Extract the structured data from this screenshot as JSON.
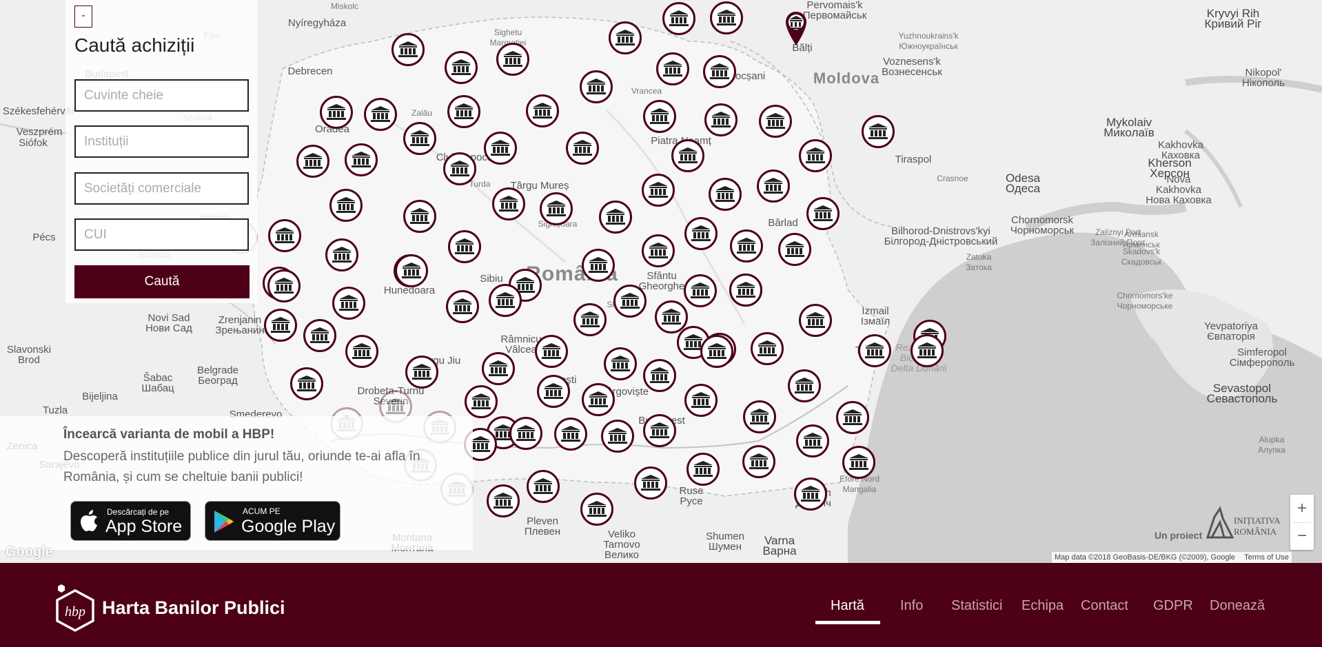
{
  "search_panel": {
    "collapse_label": "-",
    "title": "Caută achiziții",
    "keywords_placeholder": "Cuvinte cheie",
    "institutions_placeholder": "Instituții",
    "companies_placeholder": "Societăți comerciale",
    "cui_placeholder": "CUI",
    "search_button": "Caută"
  },
  "promo": {
    "title": "Încearcă varianta de mobil a HBP!",
    "text": "Descoperă instituțiile publice din jurul tău, oriunde te-ai afla în România, și cum se cheltuie banii publici!",
    "app_store": {
      "line1": "Descărcați de pe",
      "line2": "App Store"
    },
    "google_play": {
      "line1": "ACUM PE",
      "line2": "Google Play"
    }
  },
  "map": {
    "zoom_in": "+",
    "zoom_out": "−",
    "google_logo": "Google",
    "attribution": "Map data ©2018 GeoBasis-DE/BKG (©2009), Google",
    "terms": "Terms of Use",
    "project_by": "Un proiect",
    "partner_logo": "INIȚIATIVA ROMÂNIA",
    "labels": [
      {
        "t": "Miskolc",
        "k": "sm"
      },
      {
        "t": "Eger",
        "k": "sm"
      },
      {
        "t": "Nyíregyháza",
        "k": ""
      },
      {
        "t": "Sighetu\nMarmației",
        "k": "sm"
      },
      {
        "t": "Budapest",
        "k": ""
      },
      {
        "t": "Debrecen",
        "k": ""
      },
      {
        "t": "Bălți",
        "k": ""
      },
      {
        "t": "Moldova",
        "k": "country"
      },
      {
        "t": "Székesfehérvár",
        "k": ""
      },
      {
        "t": "Veszprém",
        "k": ""
      },
      {
        "t": "Siófok",
        "k": ""
      },
      {
        "t": "Szolnok",
        "k": "sm"
      },
      {
        "t": "Oradea",
        "k": ""
      },
      {
        "t": "Zalău",
        "k": "sm"
      },
      {
        "t": "Cluj-Napoca",
        "k": ""
      },
      {
        "t": "Târgu Mureș",
        "k": ""
      },
      {
        "t": "Piatra Neamț",
        "k": ""
      },
      {
        "t": "Tiraspol",
        "k": ""
      },
      {
        "t": "Szeged",
        "k": "sm"
      },
      {
        "t": "Pécs",
        "k": ""
      },
      {
        "t": "Turda",
        "k": "sm"
      },
      {
        "t": "Sighișoara",
        "k": "sm"
      },
      {
        "t": "Bârlad",
        "k": ""
      },
      {
        "t": "Subotica",
        "k": "sm"
      },
      {
        "t": "Sibiu",
        "k": ""
      },
      {
        "t": "România",
        "k": "big"
      },
      {
        "t": "Sfântu\nGheorghe",
        "k": ""
      },
      {
        "t": "Hunedoara",
        "k": ""
      },
      {
        "t": "Novi Sad\nНови Сад",
        "k": ""
      },
      {
        "t": "Zrenjanin\nЗрењанин",
        "k": ""
      },
      {
        "t": "Sinaia",
        "k": "sm"
      },
      {
        "t": "Slavonski\nBrod",
        "k": ""
      },
      {
        "t": "Târgu Jiu",
        "k": ""
      },
      {
        "t": "Belgrade\nБеоград",
        "k": ""
      },
      {
        "t": "Šabac\nШабац",
        "k": ""
      },
      {
        "t": "Drobeta-Turnu\nSeverin",
        "k": ""
      },
      {
        "t": "Pitești",
        "k": ""
      },
      {
        "t": "Târgoviște",
        "k": ""
      },
      {
        "t": "Bijeljina",
        "k": ""
      },
      {
        "t": "Tuzla",
        "k": ""
      },
      {
        "t": "Smederevo",
        "k": ""
      },
      {
        "t": "Zenica",
        "k": ""
      },
      {
        "t": "Sarajevo",
        "k": ""
      },
      {
        "t": "Montana\nМонтана",
        "k": ""
      },
      {
        "t": "Pleven\nПлевен",
        "k": ""
      },
      {
        "t": "Veliko\nTarnovo\nВелико",
        "k": ""
      },
      {
        "t": "Ruse\nРусе",
        "k": ""
      },
      {
        "t": "Shumen\nШумен",
        "k": ""
      },
      {
        "t": "Varna\nВарна",
        "k": "dark"
      },
      {
        "t": "Dobrich\nДобрич",
        "k": ""
      },
      {
        "t": "Efore Nord\nMangalia",
        "k": "sm"
      },
      {
        "t": "Tulcea",
        "k": ""
      },
      {
        "t": "Izmail\nІзмаїл",
        "k": ""
      },
      {
        "t": "Rezervația\nBiosferei\nDelta Dunării",
        "k": "sea"
      },
      {
        "t": "Bilhorod-Dnistrovs'kyi\nБілгород-Дністровський",
        "k": ""
      },
      {
        "t": "Zatoka\nЗатока",
        "k": "sm"
      },
      {
        "t": "Odesa\nОдеса",
        "k": "dark"
      },
      {
        "t": "Chornomorsk\nЧорноморськ",
        "k": ""
      },
      {
        "t": "Zaliznyi Port\nЗалізний Порт",
        "k": "sm"
      },
      {
        "t": "Skadovs'k\nСкадовськ",
        "k": "sm"
      },
      {
        "t": "Armiansk\nАрмянськ",
        "k": "sm"
      },
      {
        "t": "Chornomors'ke\nЧорноморське",
        "k": "sm"
      },
      {
        "t": "Yevpatoriya\nЄвпаторія",
        "k": ""
      },
      {
        "t": "Simferopol\nСімферополь",
        "k": ""
      },
      {
        "t": "Sevastopol\nСевастополь",
        "k": "dark"
      },
      {
        "t": "Alupka\nАлупка",
        "k": "sm"
      },
      {
        "t": "Kherson\nХерсон",
        "k": "dark"
      },
      {
        "t": "Nova\nKakhovka\nНова Каховка",
        "k": ""
      },
      {
        "t": "Kakhovka\nКаховка",
        "k": ""
      },
      {
        "t": "Mykolaiv\nМиколаїв",
        "k": "dark"
      },
      {
        "t": "Pervomais'k\nПервомайськ",
        "k": ""
      },
      {
        "t": "Yuzhnoukrains'k\nЮжноукраїнськ",
        "k": "sm"
      },
      {
        "t": "Voznesens'k\nВознесенськ",
        "k": ""
      },
      {
        "t": "Kryvyi Rih\nКривий Ріг",
        "k": "dark"
      },
      {
        "t": "Nikopol'\nНікополь",
        "k": ""
      },
      {
        "t": "Crasnoe",
        "k": "sm"
      },
      {
        "t": "Vrancea",
        "k": "sm"
      },
      {
        "t": "Focșani",
        "k": ""
      },
      {
        "t": "Râmnicu\nVâlcea",
        "k": ""
      },
      {
        "t": "Bucharest",
        "k": ""
      }
    ]
  },
  "footer": {
    "brand": "Harta Banilor Publici",
    "logo_text": "hbp",
    "nav": [
      "Hartă",
      "Info",
      "Statistici",
      "Echipa",
      "Contact",
      "GDPR",
      "Donează"
    ],
    "active": "Hartă"
  },
  "colors": {
    "brand": "#4d0016",
    "nav_inactive": "#c9a4ad",
    "map_bg": "#efefef",
    "sea": "#cfcfcf"
  }
}
